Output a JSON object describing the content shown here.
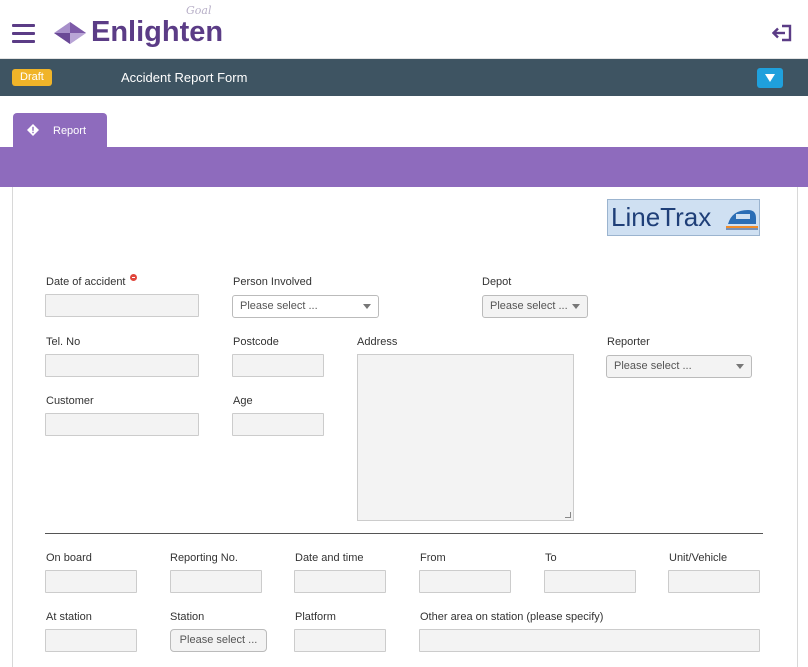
{
  "header": {
    "logo_text": "Enlighten",
    "logo_script": "Goal",
    "menu_icon": "hamburger-menu-icon",
    "logout_icon": "logout-icon"
  },
  "titlebar": {
    "status_badge": "Draft",
    "title": "Accident Report Form",
    "dropdown_icon": "triangle-down-icon"
  },
  "tabs": [
    {
      "label": "Report",
      "icon": "alert-diamond-icon"
    }
  ],
  "logo_partner": {
    "text": "LineTrax",
    "icon": "train-icon"
  },
  "form": {
    "date_of_accident": {
      "label": "Date of accident",
      "value": "",
      "required": true
    },
    "person_involved": {
      "label": "Person Involved",
      "selected": "Please select ..."
    },
    "depot": {
      "label": "Depot",
      "selected": "Please select ..."
    },
    "tel_no": {
      "label": "Tel. No",
      "value": ""
    },
    "postcode": {
      "label": "Postcode",
      "value": ""
    },
    "address": {
      "label": "Address",
      "value": ""
    },
    "reporter": {
      "label": "Reporter",
      "selected": "Please select ..."
    },
    "customer": {
      "label": "Customer",
      "value": ""
    },
    "age": {
      "label": "Age",
      "value": ""
    },
    "on_board": {
      "label": "On board",
      "value": ""
    },
    "reporting_no": {
      "label": "Reporting No.",
      "value": ""
    },
    "date_and_time": {
      "label": "Date and time",
      "value": ""
    },
    "from": {
      "label": "From",
      "value": ""
    },
    "to": {
      "label": "To",
      "value": ""
    },
    "unit_vehicle": {
      "label": "Unit/Vehicle",
      "value": ""
    },
    "at_station": {
      "label": "At station",
      "value": ""
    },
    "station": {
      "label": "Station",
      "selected": "Please select ..."
    },
    "platform": {
      "label": "Platform",
      "value": ""
    },
    "other_area": {
      "label": "Other area on station (please specify)",
      "value": ""
    }
  },
  "colors": {
    "brand_purple": "#5b3c86",
    "tab_purple": "#8e6bbd",
    "titlebar": "#3e5462",
    "badge": "#f0b429",
    "accent_blue": "#1fa0dc"
  }
}
